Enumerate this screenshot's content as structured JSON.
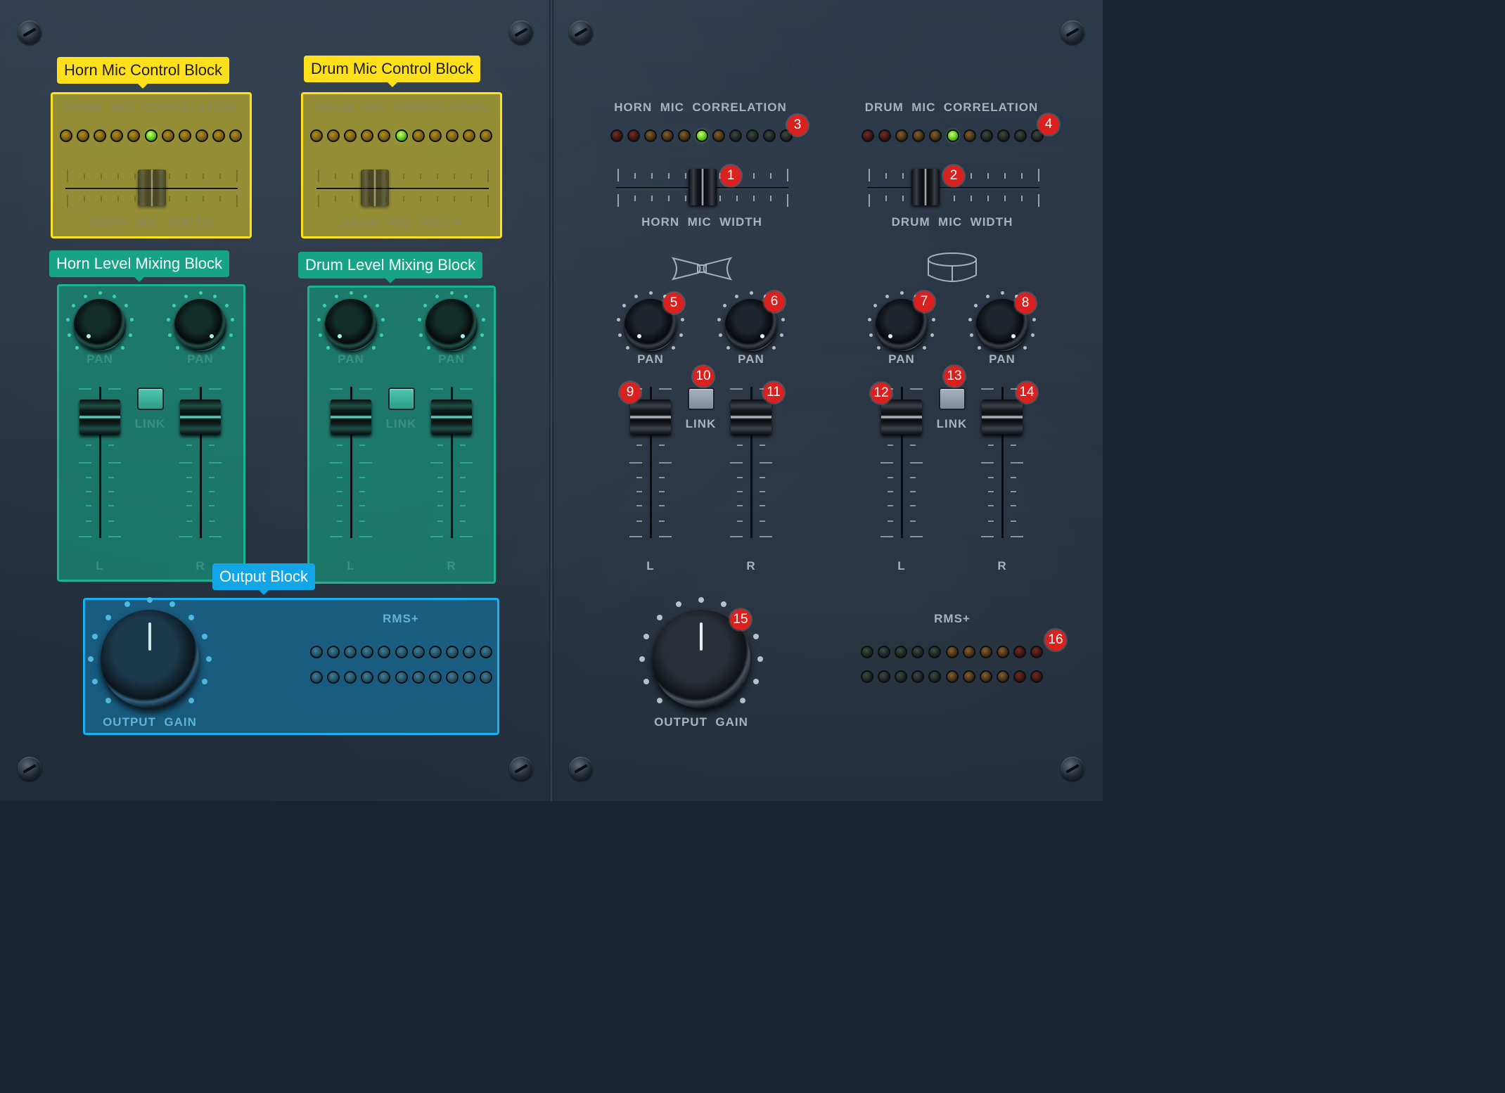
{
  "annotation_tags": {
    "horn_control": "Horn Mic Control Block",
    "drum_control": "Drum Mic Control Block",
    "horn_mixing": "Horn Level Mixing Block",
    "drum_mixing": "Drum Level Mixing Block",
    "output": "Output Block"
  },
  "labels": {
    "horn_correlation": "HORN  MIC  CORRELATION",
    "drum_correlation": "DRUM  MIC  CORRELATION",
    "horn_width": "HORN  MIC  WIDTH",
    "drum_width": "DRUM  MIC  WIDTH",
    "pan": "PAN",
    "link": "LINK",
    "left": "L",
    "right": "R",
    "output_gain": "OUTPUT  GAIN",
    "rms": "RMS+"
  },
  "controls": {
    "horn_mic_width": {
      "value": 0.5
    },
    "drum_mic_width": {
      "value": 0.34
    },
    "horn_correlation_active_led": 6,
    "drum_correlation_active_led": 6,
    "correlation_led_count": 11,
    "rms_led_count": 11,
    "rms_rows": 2
  },
  "badges": [
    "1",
    "2",
    "3",
    "4",
    "5",
    "6",
    "7",
    "8",
    "9",
    "10",
    "11",
    "12",
    "13",
    "14",
    "15",
    "16"
  ],
  "colors": {
    "yellow_highlight": "#ffe01a",
    "green_highlight": "#17a486",
    "blue_highlight": "#13a6e6",
    "badge_red": "#d9221f"
  }
}
